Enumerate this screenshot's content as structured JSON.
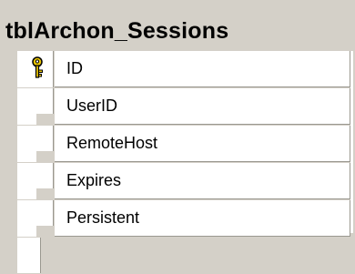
{
  "table": {
    "title": "tblArchon_Sessions",
    "columns": [
      {
        "name": "ID",
        "primary_key": true
      },
      {
        "name": "UserID",
        "primary_key": false
      },
      {
        "name": "RemoteHost",
        "primary_key": false
      },
      {
        "name": "Expires",
        "primary_key": false
      },
      {
        "name": "Persistent",
        "primary_key": false
      }
    ]
  },
  "icons": {
    "primary_key": "key-icon"
  },
  "colors": {
    "frame": "#d4d0c8",
    "cell": "#ffffff",
    "key": "#e8c400"
  }
}
